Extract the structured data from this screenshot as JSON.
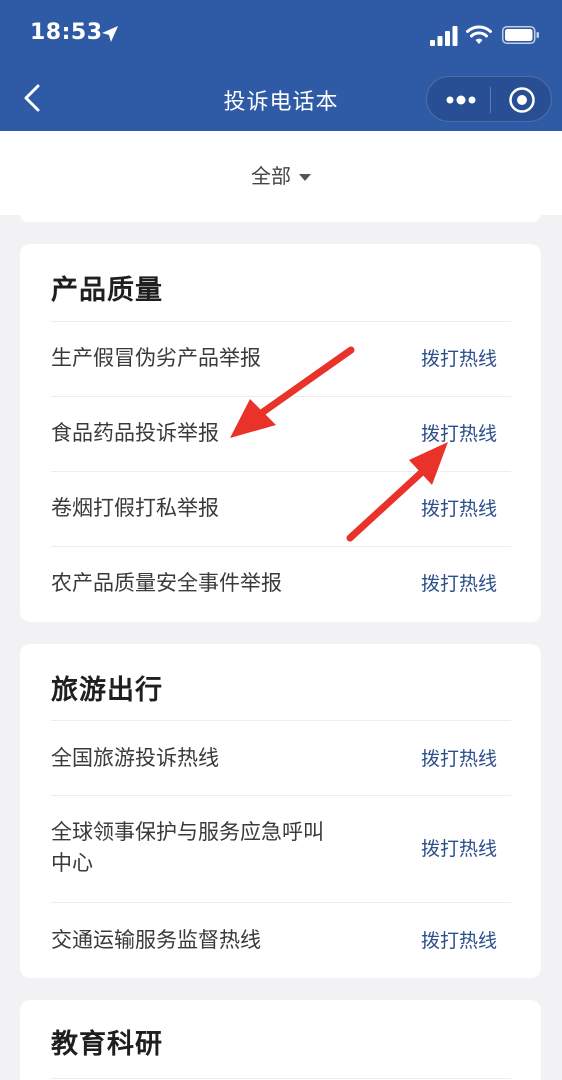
{
  "status_bar": {
    "time": "18:53"
  },
  "nav": {
    "title": "投诉电话本"
  },
  "filter": {
    "label": "全部"
  },
  "sections": [
    {
      "title": "产品质量",
      "items": [
        {
          "label": "生产假冒伪劣产品举报",
          "action": "拨打热线"
        },
        {
          "label": "食品药品投诉举报",
          "action": "拨打热线"
        },
        {
          "label": "卷烟打假打私举报",
          "action": "拨打热线"
        },
        {
          "label": "农产品质量安全事件举报",
          "action": "拨打热线"
        }
      ]
    },
    {
      "title": "旅游出行",
      "items": [
        {
          "label": "全国旅游投诉热线",
          "action": "拨打热线"
        },
        {
          "label": "全球领事保护与服务应急呼叫中心",
          "action": "拨打热线"
        },
        {
          "label": "交通运输服务监督热线",
          "action": "拨打热线"
        }
      ]
    },
    {
      "title": "教育科研",
      "items": []
    }
  ],
  "colors": {
    "header_blue": "#2f5aa5",
    "action_text": "#2d4f8a",
    "annotation_red": "#e8322a"
  }
}
